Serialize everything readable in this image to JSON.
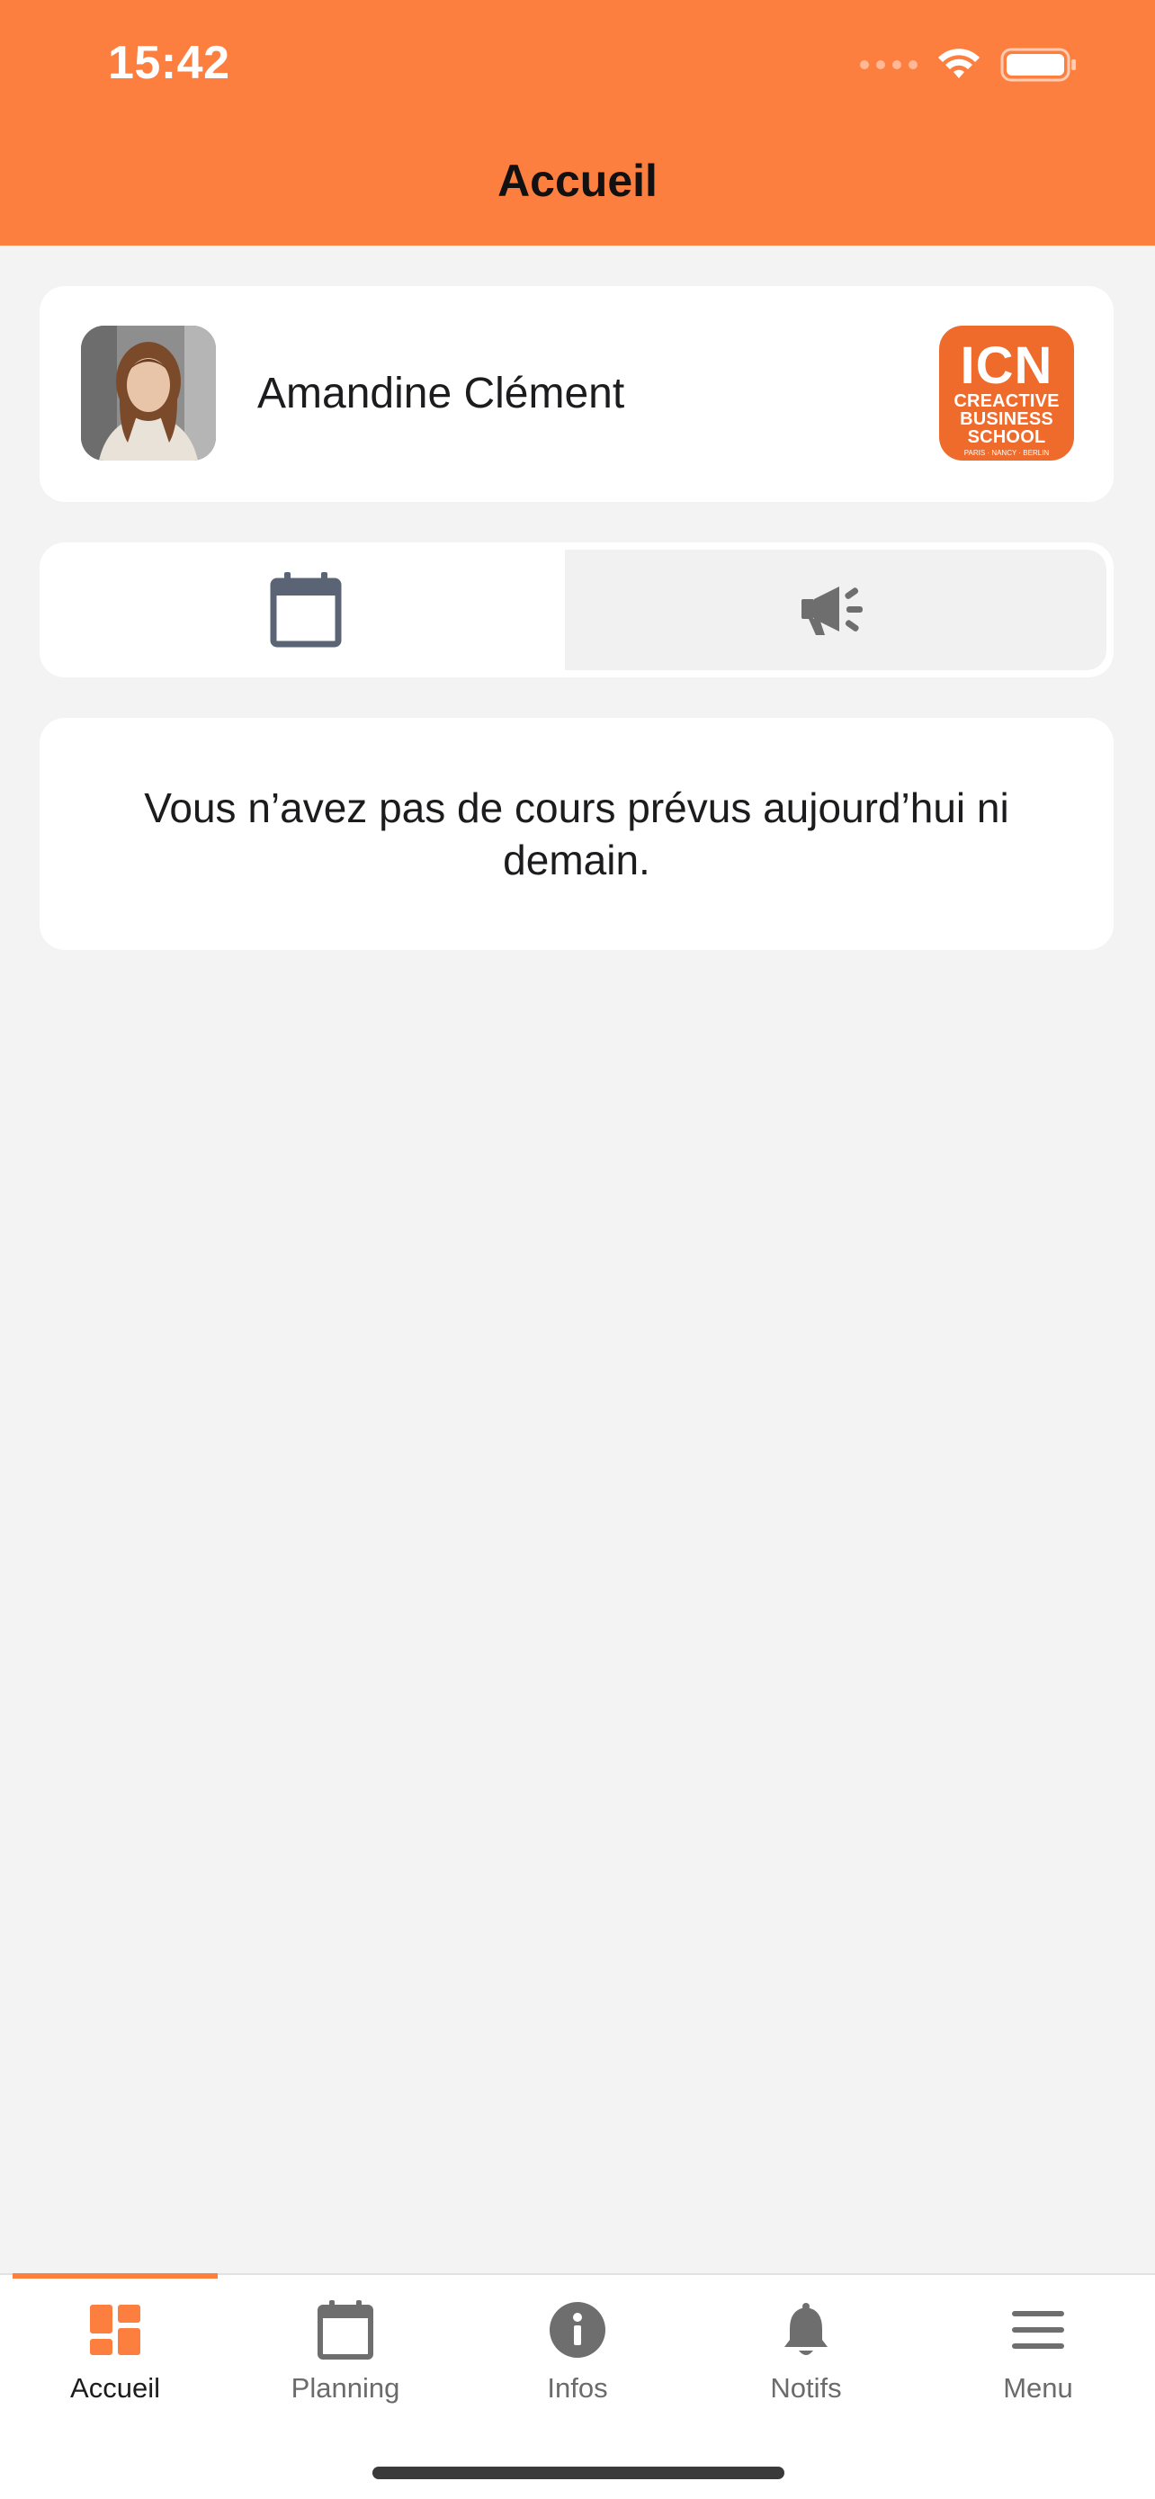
{
  "status_bar": {
    "time": "15:42"
  },
  "header": {
    "title": "Accueil"
  },
  "profile": {
    "name": "Amandine Clément"
  },
  "school_logo": {
    "line1": "ICN",
    "line2": "CREACTIVE",
    "line3": "BUSINESS",
    "line4": "SCHOOL",
    "line5": "PARIS · NANCY · BERLIN"
  },
  "tabs": [
    {
      "icon": "calendar-icon",
      "selected": true
    },
    {
      "icon": "megaphone-icon",
      "selected": false
    }
  ],
  "message": {
    "text": "Vous n’avez pas de cours prévus aujourd’hui ni demain."
  },
  "nav": {
    "items": [
      {
        "label": "Accueil",
        "icon": "dashboard-icon",
        "active": true
      },
      {
        "label": "Planning",
        "icon": "calendar-icon",
        "active": false
      },
      {
        "label": "Infos",
        "icon": "info-icon",
        "active": false
      },
      {
        "label": "Notifs",
        "icon": "bell-icon",
        "active": false
      },
      {
        "label": "Menu",
        "icon": "hamburger-menu-icon",
        "active": false
      }
    ]
  },
  "colors": {
    "accent": "#fd7f40",
    "logo_bg": "#ef6b2c",
    "icon_blue_gray": "#5a6475",
    "icon_gray": "#6e6e6e"
  }
}
